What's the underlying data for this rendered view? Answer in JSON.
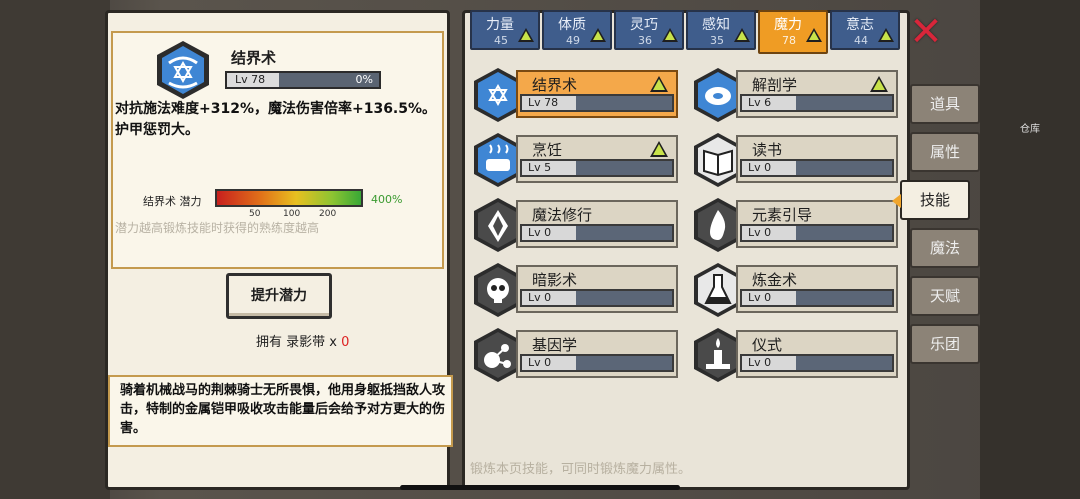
{
  "detail": {
    "name": "结界术",
    "level": "Lv 78",
    "progress_text": "0%",
    "progress": 0,
    "description": "对抗施法难度+312%，魔法伤害倍率+136.5%。护甲惩罚大。",
    "potential_label": "结界术 潜力",
    "potential_ticks": [
      "50",
      "100",
      "200"
    ],
    "potential_value": "400%",
    "potential_hint": "潜力越高锻炼技能时获得的熟练度越高"
  },
  "upgrade_button": "提升潜力",
  "own": {
    "prefix": "拥有 录影带 x",
    "count": "0"
  },
  "story": "骑着机械战马的荆棘骑士无所畏惧，他用身躯抵挡敌人攻击，特制的金属铠甲吸收攻击能量后会给予对方更大的伤害。",
  "stat_tabs": [
    {
      "name": "力量",
      "value": "45",
      "active": false
    },
    {
      "name": "体质",
      "value": "49",
      "active": false
    },
    {
      "name": "灵巧",
      "value": "36",
      "active": false
    },
    {
      "name": "感知",
      "value": "35",
      "active": false
    },
    {
      "name": "魔力",
      "value": "78",
      "active": true
    },
    {
      "name": "意志",
      "value": "44",
      "active": false
    }
  ],
  "skills": [
    {
      "name": "结界术",
      "level": "Lv 78",
      "upgradable": true,
      "icon": "hexagram-icon",
      "selected": true
    },
    {
      "name": "解剖学",
      "level": "Lv 6",
      "upgradable": true,
      "icon": "meat-icon",
      "selected": false
    },
    {
      "name": "烹饪",
      "level": "Lv 5",
      "upgradable": true,
      "icon": "pot-icon",
      "selected": false
    },
    {
      "name": "读书",
      "level": "Lv 0",
      "upgradable": false,
      "icon": "book-icon",
      "selected": false
    },
    {
      "name": "魔法修行",
      "level": "Lv 0",
      "upgradable": false,
      "icon": "crystal-icon",
      "selected": false
    },
    {
      "name": "元素引导",
      "level": "Lv 0",
      "upgradable": false,
      "icon": "flame-icon",
      "selected": false
    },
    {
      "name": "暗影术",
      "level": "Lv 0",
      "upgradable": false,
      "icon": "skull-icon",
      "selected": false
    },
    {
      "name": "炼金术",
      "level": "Lv 0",
      "upgradable": false,
      "icon": "flask-icon",
      "selected": false
    },
    {
      "name": "基因学",
      "level": "Lv 0",
      "upgradable": false,
      "icon": "molecule-icon",
      "selected": false
    },
    {
      "name": "仪式",
      "level": "Lv 0",
      "upgradable": false,
      "icon": "candle-icon",
      "selected": false
    }
  ],
  "bottom_hint": "锻炼本页技能，可同时锻炼魔力属性。",
  "side_tabs": [
    {
      "label": "道具",
      "active": false
    },
    {
      "label": "属性",
      "active": false
    },
    {
      "label": "技能",
      "active": true
    },
    {
      "label": "魔法",
      "active": false
    },
    {
      "label": "天赋",
      "active": false
    },
    {
      "label": "乐团",
      "active": false
    }
  ],
  "warehouse_label": "仓库",
  "colors": {
    "active_tab": "#ef9c24",
    "stat_tab": "#3f5d8c",
    "upgrade_arrow": "#c8e24a",
    "close": "#d8263a"
  }
}
